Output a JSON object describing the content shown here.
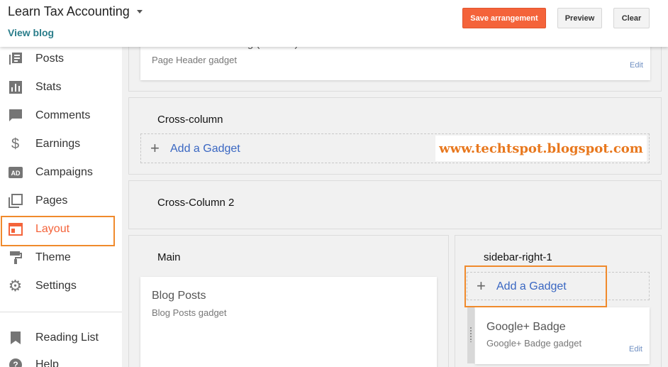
{
  "header": {
    "blog_title": "Learn Tax Accounting",
    "view_blog": "View blog",
    "save_label": "Save arrangement",
    "preview_label": "Preview",
    "clear_label": "Clear",
    "accent_color": "#f4633a"
  },
  "sidebar": {
    "items": [
      {
        "label": "Posts",
        "icon": "posts-icon"
      },
      {
        "label": "Stats",
        "icon": "stats-icon"
      },
      {
        "label": "Comments",
        "icon": "comments-icon"
      },
      {
        "label": "Earnings",
        "icon": "dollar-icon"
      },
      {
        "label": "Campaigns",
        "icon": "campaigns-icon"
      },
      {
        "label": "Pages",
        "icon": "pages-icon"
      },
      {
        "label": "Layout",
        "icon": "layout-icon",
        "active": true
      },
      {
        "label": "Theme",
        "icon": "paint-roller-icon"
      },
      {
        "label": "Settings",
        "icon": "gear-icon"
      }
    ],
    "secondary": [
      {
        "label": "Reading List",
        "icon": "bookmark-icon"
      },
      {
        "label": "Help",
        "icon": "help-icon"
      }
    ]
  },
  "layout": {
    "header_section": {
      "gadget_title": "Learn Tax Accounting (Header)",
      "gadget_sub": "Page Header gadget",
      "edit": "Edit"
    },
    "cross_column": {
      "title": "Cross-column",
      "add_gadget": "Add a Gadget"
    },
    "cross_column_2": {
      "title": "Cross-Column 2"
    },
    "main": {
      "title": "Main",
      "gadget_title": "Blog Posts",
      "gadget_sub": "Blog Posts gadget"
    },
    "sidebar_right": {
      "title": "sidebar-right-1",
      "add_gadget": "Add a Gadget",
      "gadget_title": "Google+ Badge",
      "gadget_sub": "Google+ Badge gadget",
      "edit": "Edit"
    }
  },
  "watermark": "www.techtspot.blogspot.com"
}
